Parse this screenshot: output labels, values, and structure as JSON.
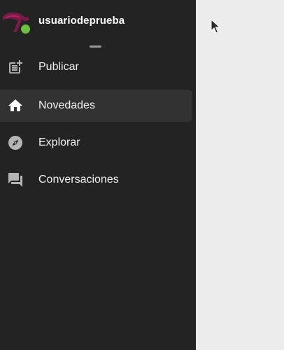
{
  "profile": {
    "username": "usuariodeprueba",
    "avatar_icon": "logo-avatar-icon",
    "status_color": "#6fbf3f",
    "avatar_color": "#7a1a47"
  },
  "nav": {
    "items": [
      {
        "label": "Publicar",
        "icon": "post-add-icon",
        "active": false
      },
      {
        "label": "Novedades",
        "icon": "home-icon",
        "active": true
      },
      {
        "label": "Explorar",
        "icon": "compass-icon",
        "active": false
      },
      {
        "label": "Conversaciones",
        "icon": "forum-icon",
        "active": false
      }
    ]
  },
  "theme": {
    "sidebar_bg": "#232323",
    "active_bg": "#323232",
    "content_bg": "#ececec",
    "text": "#f0f0f0",
    "icon": "#b5b5b5"
  }
}
